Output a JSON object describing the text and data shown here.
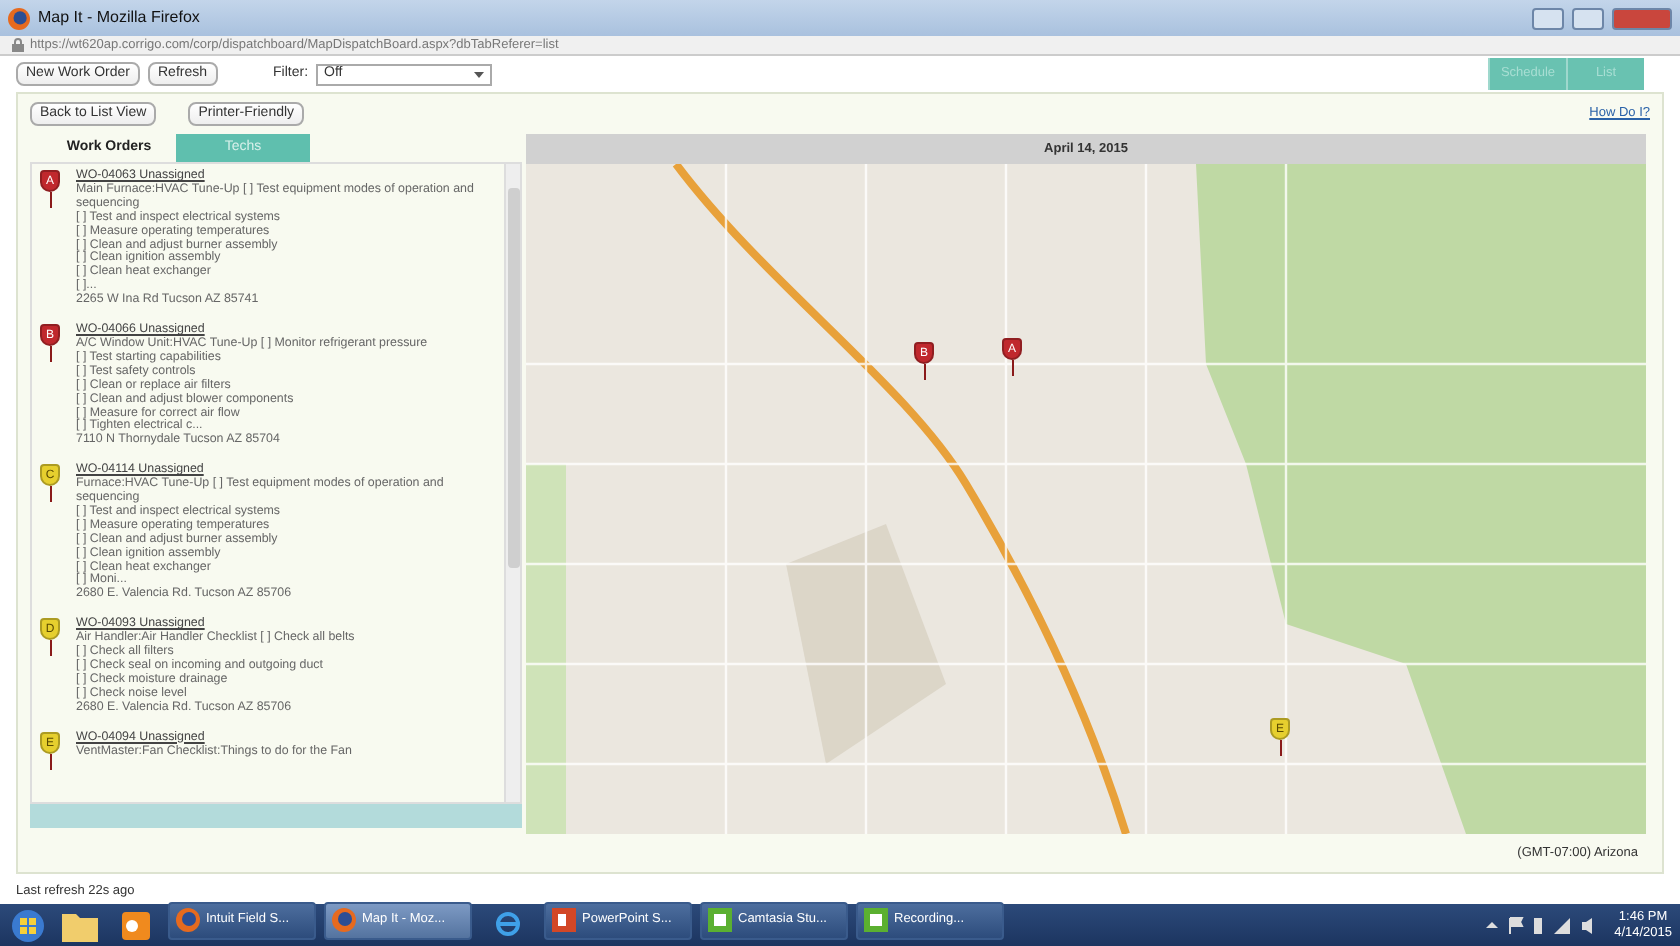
{
  "window": {
    "title": "Map It - Mozilla Firefox",
    "url": "https://wt620ap.corrigo.com/corp/dispatchboard/MapDispatchBoard.aspx?dbTabReferer=list"
  },
  "toolbar": {
    "buttons": [
      "New Work Order",
      "Refresh"
    ],
    "filter": {
      "label": "Filter:",
      "value": "Off"
    },
    "view_tabs": [
      {
        "label": "Schedule",
        "selected": false
      },
      {
        "label": "List",
        "selected": false
      }
    ]
  },
  "actions": {
    "buttons": [
      "Back to List View",
      "Printer-Friendly"
    ],
    "help_link": "How Do I?"
  },
  "list_tabs": [
    {
      "label": "Work Orders",
      "selected": true
    },
    {
      "label": "Techs",
      "selected": false
    }
  ],
  "work_orders": [
    {
      "marker": "A",
      "color": "#c0282d",
      "title": "WO-04063 Unassigned",
      "lines": [
        "Main Furnace:HVAC Tune-Up [ ] Test equipment modes of operation and sequencing",
        "[ ] Test and inspect electrical systems",
        "[ ] Measure operating temperatures",
        "[ ] Clean and adjust burner assembly",
        "[ ] Clean ignition assembly",
        "[ ] Clean heat exchanger",
        "[ ]..."
      ],
      "address": "2265 W Ina Rd Tucson AZ 85741"
    },
    {
      "marker": "B",
      "color": "#c0282d",
      "title": "WO-04066 Unassigned",
      "lines": [
        "A/C Window Unit:HVAC Tune-Up [ ] Monitor refrigerant pressure",
        "[ ] Test starting capabilities",
        "[ ] Test safety controls",
        "[ ] Clean or replace air filters",
        "[ ] Clean and adjust blower components",
        "[ ] Measure for correct air flow",
        "[ ] Tighten electrical c..."
      ],
      "address": "7110 N Thornydale Tucson AZ 85704"
    },
    {
      "marker": "C",
      "color": "#e6cf2e",
      "title": "WO-04114 Unassigned",
      "lines": [
        "Furnace:HVAC Tune-Up [ ] Test equipment modes of operation and sequencing",
        "[ ] Test and inspect electrical systems",
        "[ ] Measure operating temperatures",
        "[ ] Clean and adjust burner assembly",
        "[ ] Clean ignition assembly",
        "[ ] Clean heat exchanger",
        "[ ] Moni..."
      ],
      "address": "2680 E. Valencia Rd. Tucson AZ 85706"
    },
    {
      "marker": "D",
      "color": "#e6cf2e",
      "title": "WO-04093 Unassigned",
      "lines": [
        "Air Handler:Air Handler Checklist [ ] Check all belts",
        "[ ] Check all filters",
        "[ ] Check seal on incoming and outgoing duct",
        "[ ] Check moisture drainage",
        "[ ] Check noise level"
      ],
      "address": "2680 E. Valencia Rd. Tucson AZ 85706"
    },
    {
      "marker": "E",
      "color": "#e6cf2e",
      "title": "WO-04094 Unassigned",
      "lines": [
        "VentMaster:Fan Checklist:Things to do for the Fan"
      ]
    }
  ],
  "map": {
    "date": "April 14, 2015",
    "pins": [
      {
        "marker": "B",
        "color": "#c0282d"
      },
      {
        "marker": "A",
        "color": "#c0282d"
      },
      {
        "marker": "E",
        "color": "#e6cf2e"
      }
    ],
    "timezone": "(GMT-07:00) Arizona"
  },
  "status": "Last refresh 22s ago",
  "taskbar": {
    "tasks": [
      {
        "kind": "firefox",
        "label": "Intuit Field S...",
        "selected": false
      },
      {
        "kind": "firefox",
        "label": "Map It - Moz...",
        "selected": true
      },
      {
        "kind": "ie"
      },
      {
        "kind": "powerpoint",
        "label": "PowerPoint S...",
        "selected": false
      },
      {
        "kind": "camtasia",
        "label": "Camtasia Stu...",
        "selected": false
      },
      {
        "kind": "camtasia",
        "label": "Recording...",
        "selected": false
      }
    ],
    "clock": {
      "time": "1:46 PM",
      "date": "4/14/2015"
    }
  }
}
